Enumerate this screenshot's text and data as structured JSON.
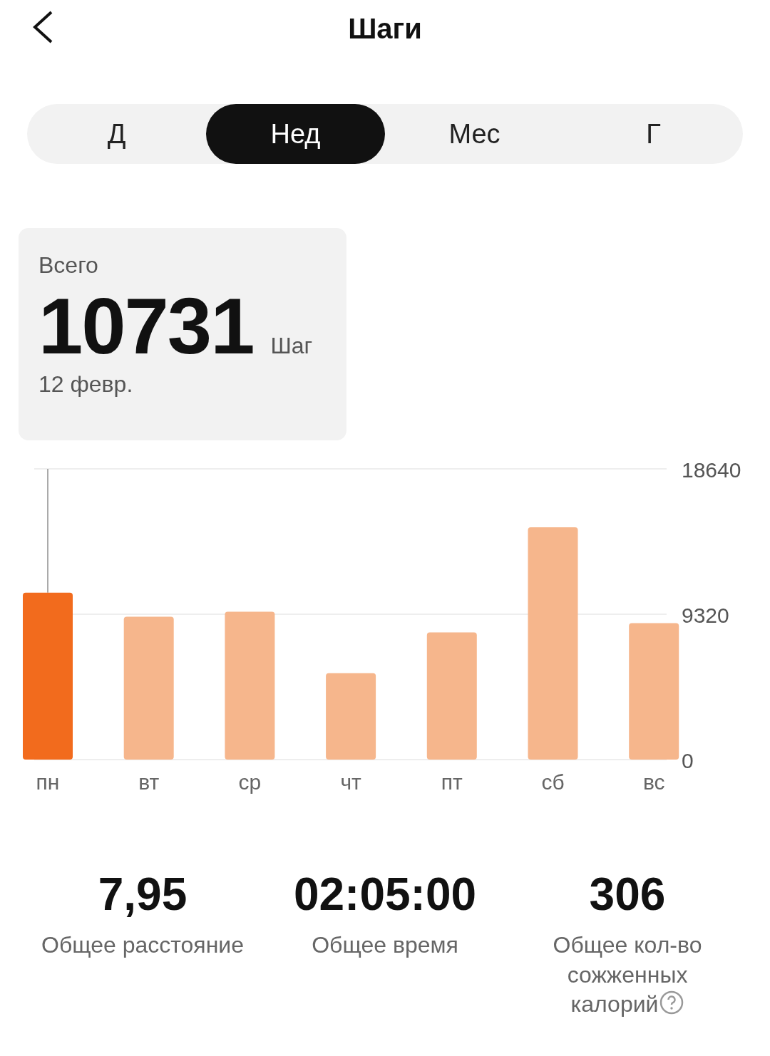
{
  "header": {
    "title": "Шаги"
  },
  "tabs": [
    {
      "label": "Д",
      "selected": false
    },
    {
      "label": "Нед",
      "selected": true
    },
    {
      "label": "Мес",
      "selected": false
    },
    {
      "label": "Г",
      "selected": false
    }
  ],
  "summary": {
    "label": "Всего",
    "value": "10731",
    "unit": "Шаг",
    "date": "12 февр."
  },
  "chart": {
    "chart_data": {
      "type": "bar",
      "categories": [
        "пн",
        "вт",
        "ср",
        "чт",
        "пт",
        "сб",
        "вс"
      ],
      "stacked": true,
      "ylim": [
        0,
        18640
      ],
      "yticks": [
        0,
        9320,
        18640
      ],
      "series": [
        {
          "color": "#f26b1d",
          "values": [
            10700,
            null,
            null,
            null,
            null,
            null,
            null
          ]
        },
        {
          "color": "#f6b68c",
          "values": [
            null,
            9160,
            9480,
            5540,
            8150,
            14890,
            8750
          ]
        }
      ]
    }
  },
  "stats": [
    {
      "value": "7,95",
      "label": "Общее расстояние",
      "help": false
    },
    {
      "value": "02:05:00",
      "label": "Общее время",
      "help": false
    },
    {
      "value": "306",
      "label": "Общее кол-во сожженных калорий",
      "help": true
    }
  ]
}
